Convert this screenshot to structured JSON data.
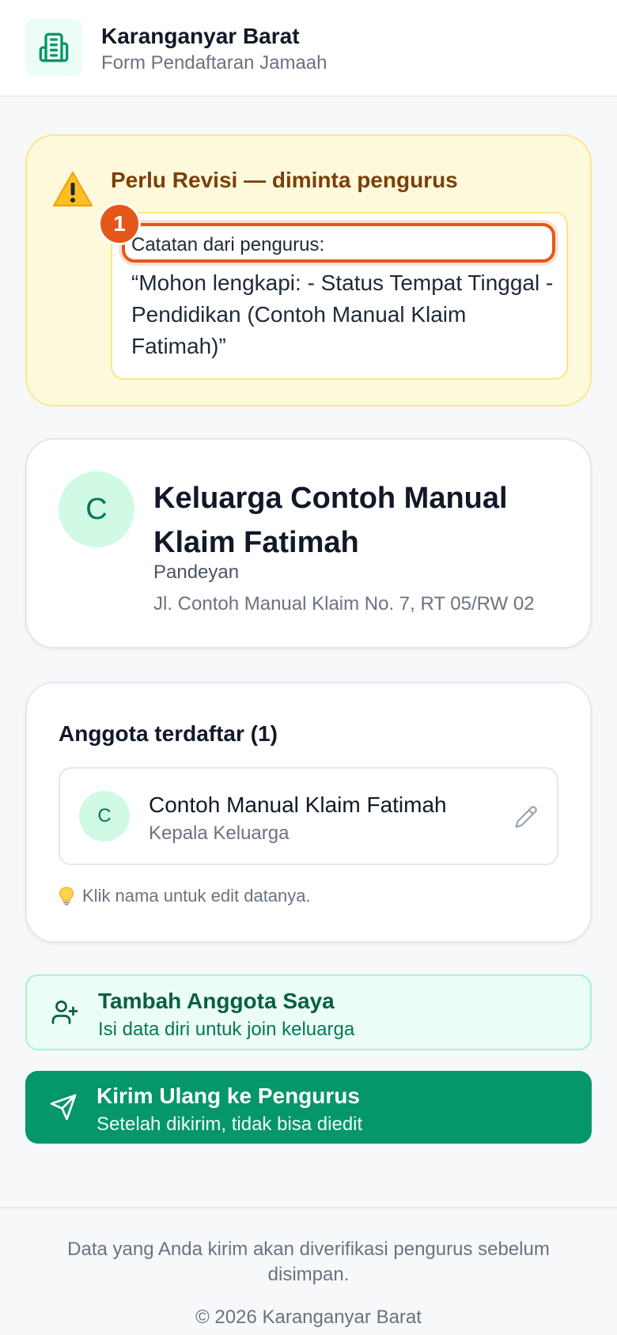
{
  "header": {
    "title": "Karanganyar Barat",
    "subtitle": "Form Pendaftaran Jamaah",
    "logo_icon": "building-icon",
    "accent": "#047857"
  },
  "alert": {
    "icon": "warning-icon",
    "title": "Perlu Revisi — diminta pengurus",
    "note_label": "Catatan dari pengurus:",
    "note_text": "“Mohon lengkapi: - Status Tempat Tinggal - Pendidikan (Contoh Manual Klaim Fatimah)”",
    "step_badge": "1",
    "badge_color": "#e4571a"
  },
  "family": {
    "initial": "C",
    "name": "Keluarga Contoh Manual Klaim Fatimah",
    "village": "Pandeyan",
    "address": "Jl. Contoh Manual Klaim No. 7, RT 05/RW 02"
  },
  "members": {
    "title": "Anggota terdaftar (1)",
    "items": [
      {
        "initial": "C",
        "name": "Contoh Manual Klaim Fatimah",
        "role": "Kepala Keluarga",
        "action_icon": "pencil-icon"
      }
    ],
    "hint": "Klik nama untuk edit datanya.",
    "hint_icon": "lightbulb-icon"
  },
  "actions": {
    "add": {
      "icon": "user-plus-icon",
      "title": "Tambah Anggota Saya",
      "subtitle": "Isi data diri untuk join keluarga"
    },
    "send": {
      "icon": "send-icon",
      "title": "Kirim Ulang ke Pengurus",
      "subtitle": "Setelah dikirim, tidak bisa diedit",
      "color": "#059669"
    }
  },
  "footer": {
    "note": "Data yang Anda kirim akan diverifikasi pengurus sebelum disimpan.",
    "copyright": "© 2026 Karanganyar Barat"
  }
}
